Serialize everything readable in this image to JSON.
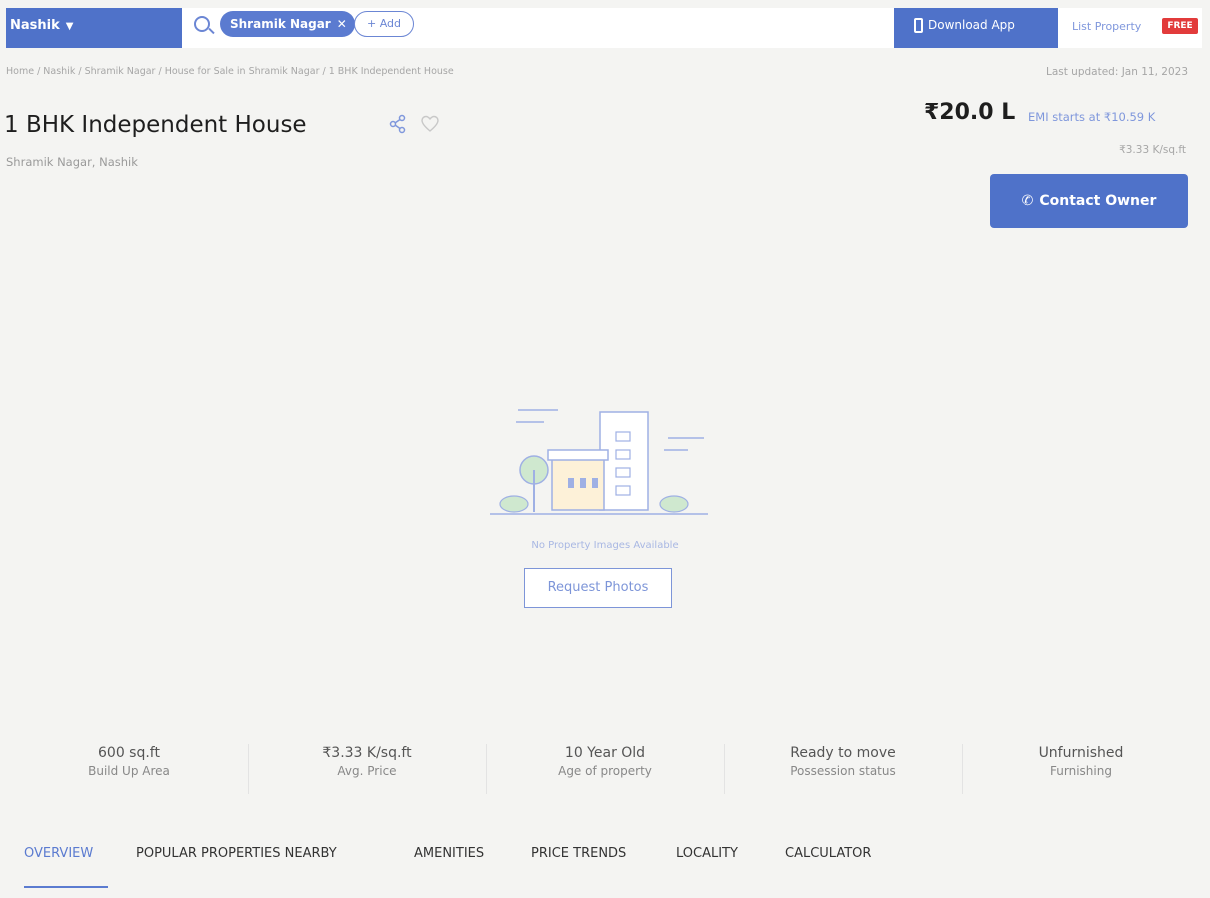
{
  "topbar": {
    "city": "Nashik",
    "chip_label": "Shramik Nagar",
    "add_label": "+ Add",
    "download_label": "Download App",
    "list_label": "List Property",
    "free_badge": "FREE"
  },
  "breadcrumb": "Home / Nashik / Shramik Nagar / House for Sale in Shramik Nagar / 1 BHK Independent House",
  "last_updated": "Last updated: Jan 11, 2023",
  "property": {
    "title": "1 BHK Independent House",
    "locality": "Shramik Nagar, Nashik",
    "price": "₹20.0 L",
    "emi": "EMI starts at ₹10.59 K",
    "price_per_sqft": "₹3.33 K/sq.ft",
    "contact_label": "Contact Owner"
  },
  "placeholder": {
    "no_images_text": "No Property Images Available",
    "request_label": "Request Photos"
  },
  "stats": [
    {
      "value": "600 sq.ft",
      "label": "Build Up Area"
    },
    {
      "value": "₹3.33 K/sq.ft",
      "label": "Avg. Price"
    },
    {
      "value": "10 Year Old",
      "label": "Age of property"
    },
    {
      "value": "Ready to move",
      "label": "Possession status"
    },
    {
      "value": "Unfurnished",
      "label": "Furnishing"
    }
  ],
  "tabs": [
    "OVERVIEW",
    "POPULAR PROPERTIES NEARBY",
    "AMENITIES",
    "PRICE TRENDS",
    "LOCALITY",
    "CALCULATOR"
  ],
  "colors": {
    "accent": "#4f72c9",
    "badge": "#e23b3b"
  },
  "icons": [
    "search-icon",
    "close-icon",
    "phone-icon",
    "share-icon",
    "heart-icon",
    "call-icon",
    "building-illustration"
  ]
}
